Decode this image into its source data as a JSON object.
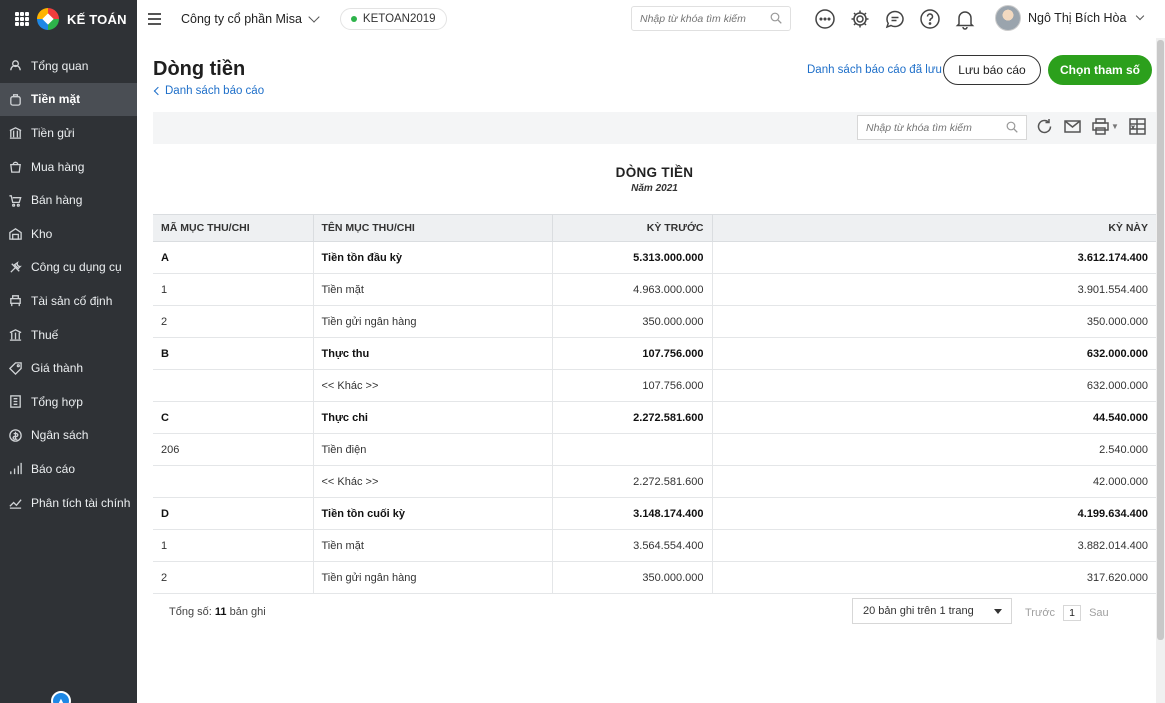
{
  "brand": {
    "name": "KẾ TOÁN"
  },
  "sidebar": {
    "items": [
      {
        "label": "Tổng quan",
        "icon": "overview-icon"
      },
      {
        "label": "Tiền mặt",
        "icon": "cash-icon",
        "active": true
      },
      {
        "label": "Tiền gửi",
        "icon": "bank-icon"
      },
      {
        "label": "Mua hàng",
        "icon": "purchase-icon"
      },
      {
        "label": "Bán hàng",
        "icon": "cart-icon"
      },
      {
        "label": "Kho",
        "icon": "warehouse-icon"
      },
      {
        "label": "Công cụ dụng cụ",
        "icon": "tools-icon"
      },
      {
        "label": "Tài sản cố định",
        "icon": "asset-icon"
      },
      {
        "label": "Thuế",
        "icon": "tax-icon"
      },
      {
        "label": "Giá thành",
        "icon": "tag-icon"
      },
      {
        "label": "Tổng hợp",
        "icon": "ledger-icon"
      },
      {
        "label": "Ngân sách",
        "icon": "budget-icon"
      },
      {
        "label": "Báo cáo",
        "icon": "report-icon"
      },
      {
        "label": "Phân tích tài chính",
        "icon": "analysis-icon"
      }
    ]
  },
  "header": {
    "company": "Công ty cổ phần Misa",
    "database": "KETOAN2019",
    "search_placeholder": "Nhập từ khóa tìm kiếm",
    "user_name": "Ngô Thị Bích Hòa"
  },
  "page": {
    "title": "Dòng tiền",
    "back_link": "Danh sách báo cáo",
    "saved_reports_link": "Danh sách báo cáo đã lưu",
    "save_button": "Lưu báo cáo",
    "params_button": "Chọn tham số"
  },
  "report": {
    "search_placeholder": "Nhập từ khóa tìm kiếm",
    "title": "DÒNG TIỀN",
    "subtitle": "Năm 2021",
    "columns": [
      "MÃ MỤC THU/CHI",
      "TÊN MỤC THU/CHI",
      "KỲ TRƯỚC",
      "KỲ NÀY"
    ],
    "rows": [
      {
        "code": "A",
        "name": "Tiền tồn đầu kỳ",
        "prev": "5.313.000.000",
        "curr": "3.612.174.400",
        "bold": true
      },
      {
        "code": "1",
        "name": "Tiền mặt",
        "prev": "4.963.000.000",
        "curr": "3.901.554.400",
        "bold": false
      },
      {
        "code": "2",
        "name": "Tiền gửi ngân hàng",
        "prev": "350.000.000",
        "curr": "350.000.000",
        "bold": false
      },
      {
        "code": "B",
        "name": "Thực thu",
        "prev": "107.756.000",
        "curr": "632.000.000",
        "bold": true
      },
      {
        "code": "",
        "name": "<< Khác >>",
        "prev": "107.756.000",
        "curr": "632.000.000",
        "bold": false
      },
      {
        "code": "C",
        "name": "Thực chi",
        "prev": "2.272.581.600",
        "curr": "44.540.000",
        "bold": true
      },
      {
        "code": "206",
        "name": "Tiền điện",
        "prev": "",
        "curr": "2.540.000",
        "bold": false
      },
      {
        "code": "",
        "name": "<< Khác >>",
        "prev": "2.272.581.600",
        "curr": "42.000.000",
        "bold": false
      },
      {
        "code": "D",
        "name": "Tiền tồn cuối kỳ",
        "prev": "3.148.174.400",
        "curr": "4.199.634.400",
        "bold": true
      },
      {
        "code": "1",
        "name": "Tiền mặt",
        "prev": "3.564.554.400",
        "curr": "3.882.014.400",
        "bold": false
      },
      {
        "code": "2",
        "name": "Tiền gửi ngân hàng",
        "prev": "350.000.000",
        "curr": "317.620.000",
        "bold": false
      }
    ],
    "total_prefix": "Tổng số:",
    "total_count": "11",
    "total_suffix": "bản ghi",
    "page_size": "20 bản ghi trên 1 trang",
    "prev_label": "Trước",
    "page_number": "1",
    "next_label": "Sau"
  },
  "colors": {
    "primary_green": "#2ca01c",
    "link_blue": "#1e6fc9",
    "sidebar_bg": "#2f3236"
  }
}
